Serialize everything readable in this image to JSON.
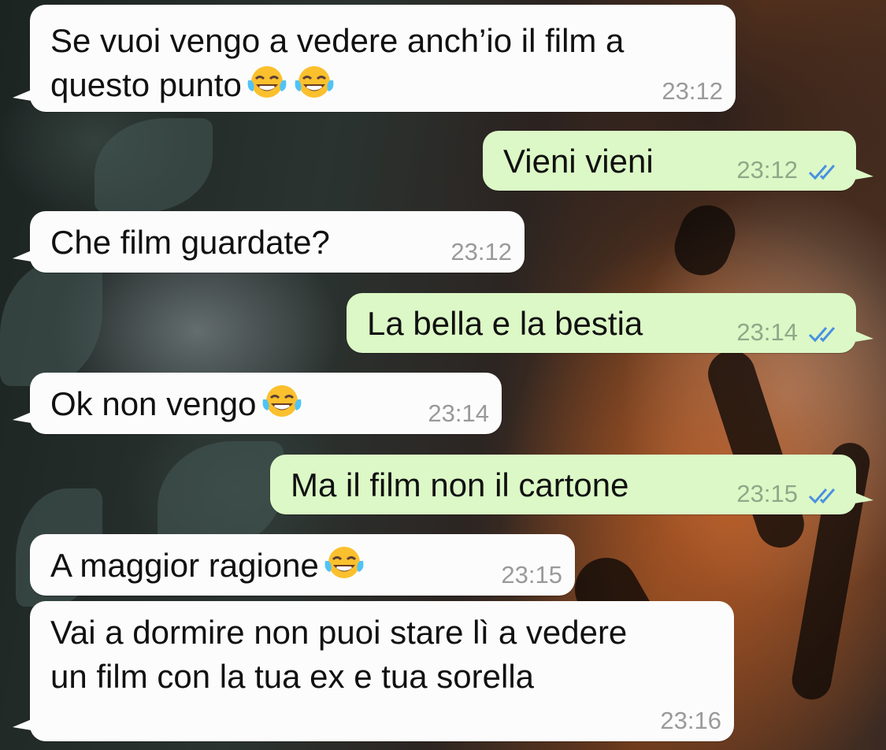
{
  "messages": [
    {
      "direction": "incoming",
      "text_lines": [
        "Se vuoi vengo a vedere anch’io il film a",
        "questo punto"
      ],
      "emoji_count": 2,
      "time": "23:12"
    },
    {
      "direction": "outgoing",
      "text_lines": [
        "Vieni vieni"
      ],
      "emoji_count": 0,
      "time": "23:12",
      "status": "read"
    },
    {
      "direction": "incoming",
      "text_lines": [
        "Che film guardate?"
      ],
      "emoji_count": 0,
      "time": "23:12"
    },
    {
      "direction": "outgoing",
      "text_lines": [
        "La bella e la bestia"
      ],
      "emoji_count": 0,
      "time": "23:14",
      "status": "read"
    },
    {
      "direction": "incoming",
      "text_lines": [
        "Ok non vengo"
      ],
      "emoji_count": 1,
      "time": "23:14"
    },
    {
      "direction": "outgoing",
      "text_lines": [
        "Ma il film non il cartone"
      ],
      "emoji_count": 0,
      "time": "23:15",
      "status": "read"
    },
    {
      "direction": "incoming",
      "text_lines": [
        "A maggior ragione"
      ],
      "emoji_count": 1,
      "time": "23:15"
    },
    {
      "direction": "incoming",
      "text_lines": [
        "Vai a dormire non puoi stare lì a vedere",
        "un film con la tua ex e tua sorella"
      ],
      "emoji_count": 0,
      "time": "23:16"
    }
  ],
  "emoji": "face-with-tears-of-joy-icon",
  "colors": {
    "incoming_bubble": "#fcfcfc",
    "outgoing_bubble": "#dcf8c6",
    "read_ticks": "#4a90e2",
    "timestamp_incoming": "#9a9a9a",
    "timestamp_outgoing": "#8fa88a"
  }
}
